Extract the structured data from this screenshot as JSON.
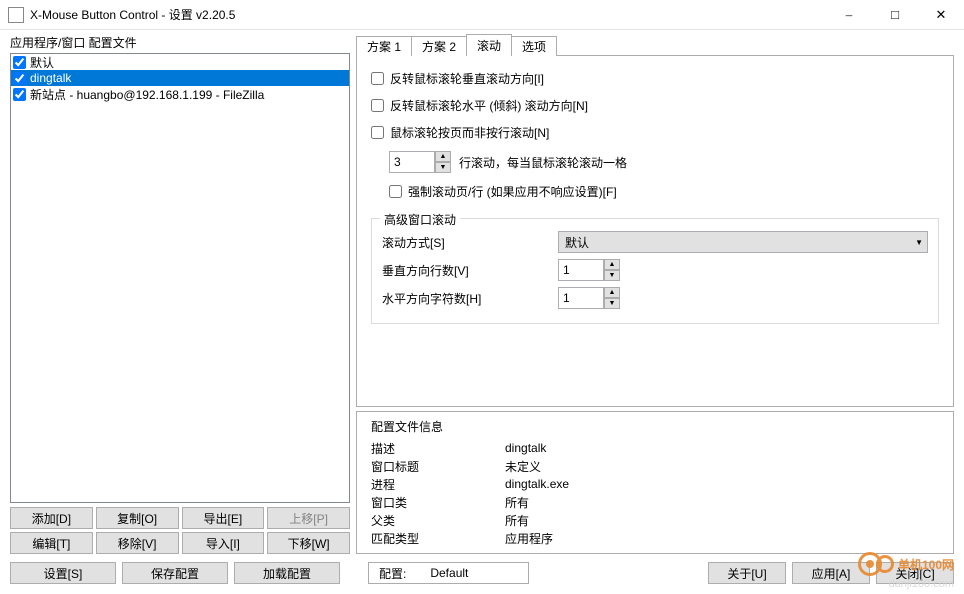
{
  "window_title": "X-Mouse Button Control - 设置 v2.20.5",
  "left_label": "应用程序/窗口 配置文件",
  "profiles": [
    {
      "label": "默认",
      "checked": true,
      "selected": false
    },
    {
      "label": "dingtalk",
      "checked": true,
      "selected": true
    },
    {
      "label": "新站点 - huangbo@192.168.1.199 - FileZilla",
      "checked": true,
      "selected": false
    }
  ],
  "profile_buttons": {
    "add": "添加[D]",
    "copy": "复制[O]",
    "export": "导出[E]",
    "up": "上移[P]",
    "edit": "编辑[T]",
    "remove": "移除[V]",
    "import": "导入[I]",
    "down": "下移[W]"
  },
  "tabs": {
    "t1": "方案 1",
    "t2": "方案 2",
    "t3": "滚动",
    "t4": "选项"
  },
  "scroll": {
    "reverse_v": "反转鼠标滚轮垂直滚动方向[I]",
    "reverse_h": "反转鼠标滚轮水平 (倾斜) 滚动方向[N]",
    "page_scroll": "鼠标滚轮按页而非按行滚动[N]",
    "lines_value": "3",
    "lines_label": "行滚动，每当鼠标滚轮滚动一格",
    "force": "强制滚动页/行 (如果应用不响应设置)[F]"
  },
  "adv": {
    "title": "高级窗口滚动",
    "method_label": "滚动方式[S]",
    "method_value": "默认",
    "vlines_label": "垂直方向行数[V]",
    "vlines_value": "1",
    "hchars_label": "水平方向字符数[H]",
    "hchars_value": "1"
  },
  "info": {
    "title": "配置文件信息",
    "rows": {
      "desc_k": "描述",
      "desc_v": "dingtalk",
      "caption_k": "窗口标题",
      "caption_v": "未定义",
      "process_k": "进程",
      "process_v": "dingtalk.exe",
      "wclass_k": "窗口类",
      "wclass_v": "所有",
      "pclass_k": "父类",
      "pclass_v": "所有",
      "match_k": "匹配类型",
      "match_v": "应用程序"
    }
  },
  "bottom": {
    "settings": "设置[S]",
    "save": "保存配置",
    "load": "加载配置",
    "config_label": "配置:",
    "config_value": "Default",
    "about": "关于[U]",
    "apply": "应用[A]",
    "close": "关闭[C]"
  },
  "watermark": {
    "text": "单机100网",
    "sub": "danji100.com"
  }
}
